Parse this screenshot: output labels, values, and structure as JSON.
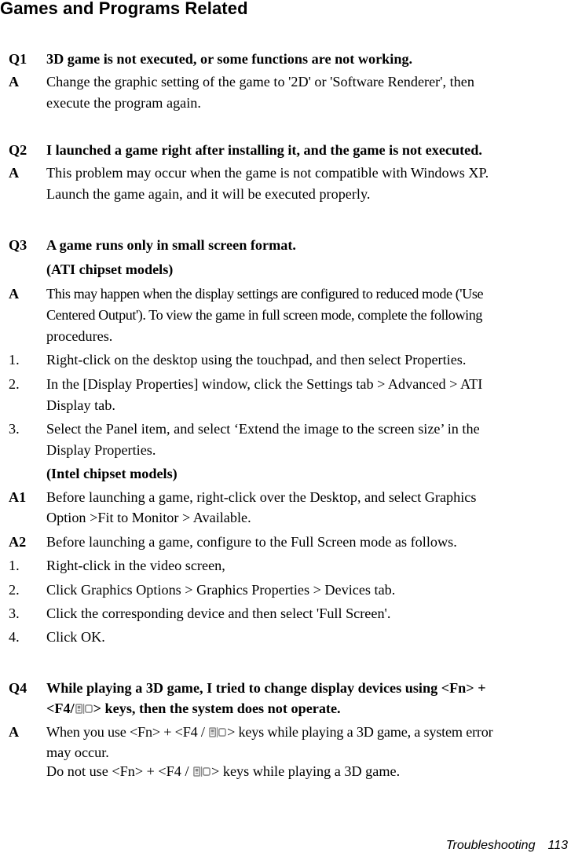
{
  "page_title": "Games and Programs Related",
  "q1": {
    "label": "Q1",
    "question": "3D game is not executed, or some functions are not working.",
    "answer_label": "A",
    "answer_l1": "Change the graphic setting of the game to '2D' or 'Software Renderer', then",
    "answer_l2": "execute the program again."
  },
  "q2": {
    "label": "Q2",
    "question": "I launched a game right after installing it, and the game is not executed.",
    "answer_label": "A",
    "answer_l1": "This problem may occur when the game is not compatible with Windows XP.",
    "answer_l2": "Launch the game again, and it will be executed properly."
  },
  "q3": {
    "label": "Q3",
    "question": "A game runs only in small screen format.",
    "ati_heading": "(ATI chipset models)",
    "answer_label": "A",
    "answer_l1": "This may happen when the display settings are configured to reduced mode ('Use",
    "answer_l2": "Centered Output'). To view the game in full screen mode, complete the following",
    "answer_l3": "procedures.",
    "ati_steps": [
      {
        "num": "1.",
        "l1": "Right-click on the desktop using the touchpad, and then select Properties.",
        "l2": ""
      },
      {
        "num": "2.",
        "l1": "In the [Display Properties] window, click the Settings tab > Advanced > ATI",
        "l2": "Display tab."
      },
      {
        "num": "3.",
        "l1": "Select the Panel item, and select ‘Extend the image to the screen size’ in the",
        "l2": "Display Properties."
      }
    ],
    "intel_heading": "(Intel chipset models)",
    "a1_label": "A1",
    "a1_l1": "Before launching a game, right-click over the Desktop, and select Graphics",
    "a1_l2": "Option >Fit to Monitor > Available.",
    "a2_label": "A2",
    "a2_text": "Before launching a game, configure to the Full Screen mode as follows.",
    "intel_steps": [
      {
        "num": "1.",
        "text": "Right-click in the video screen,"
      },
      {
        "num": "2.",
        "text": "Click Graphics Options > Graphics Properties > Devices tab."
      },
      {
        "num": "3.",
        "text": "Click the corresponding device and then select 'Full Screen'."
      },
      {
        "num": "4.",
        "text": "Click OK."
      }
    ]
  },
  "q4": {
    "label": "Q4",
    "question_l1": "While playing a 3D game, I tried to change display devices using <Fn> +",
    "question_l2_pre": "<F4/",
    "question_l2_post": "> keys, then the system does not operate.",
    "answer_label": "A",
    "answer_l1_pre": "When you use <Fn> + <F4 / ",
    "answer_l1_post": "> keys while playing a 3D game, a system error",
    "answer_l2": "may occur.",
    "answer_l3_pre": "Do not use <Fn> + <F4 / ",
    "answer_l3_post": "> keys while playing a 3D game.",
    "key_icon": "display-switch-icon"
  },
  "footer": {
    "section": "Troubleshooting",
    "page_number": "113"
  }
}
